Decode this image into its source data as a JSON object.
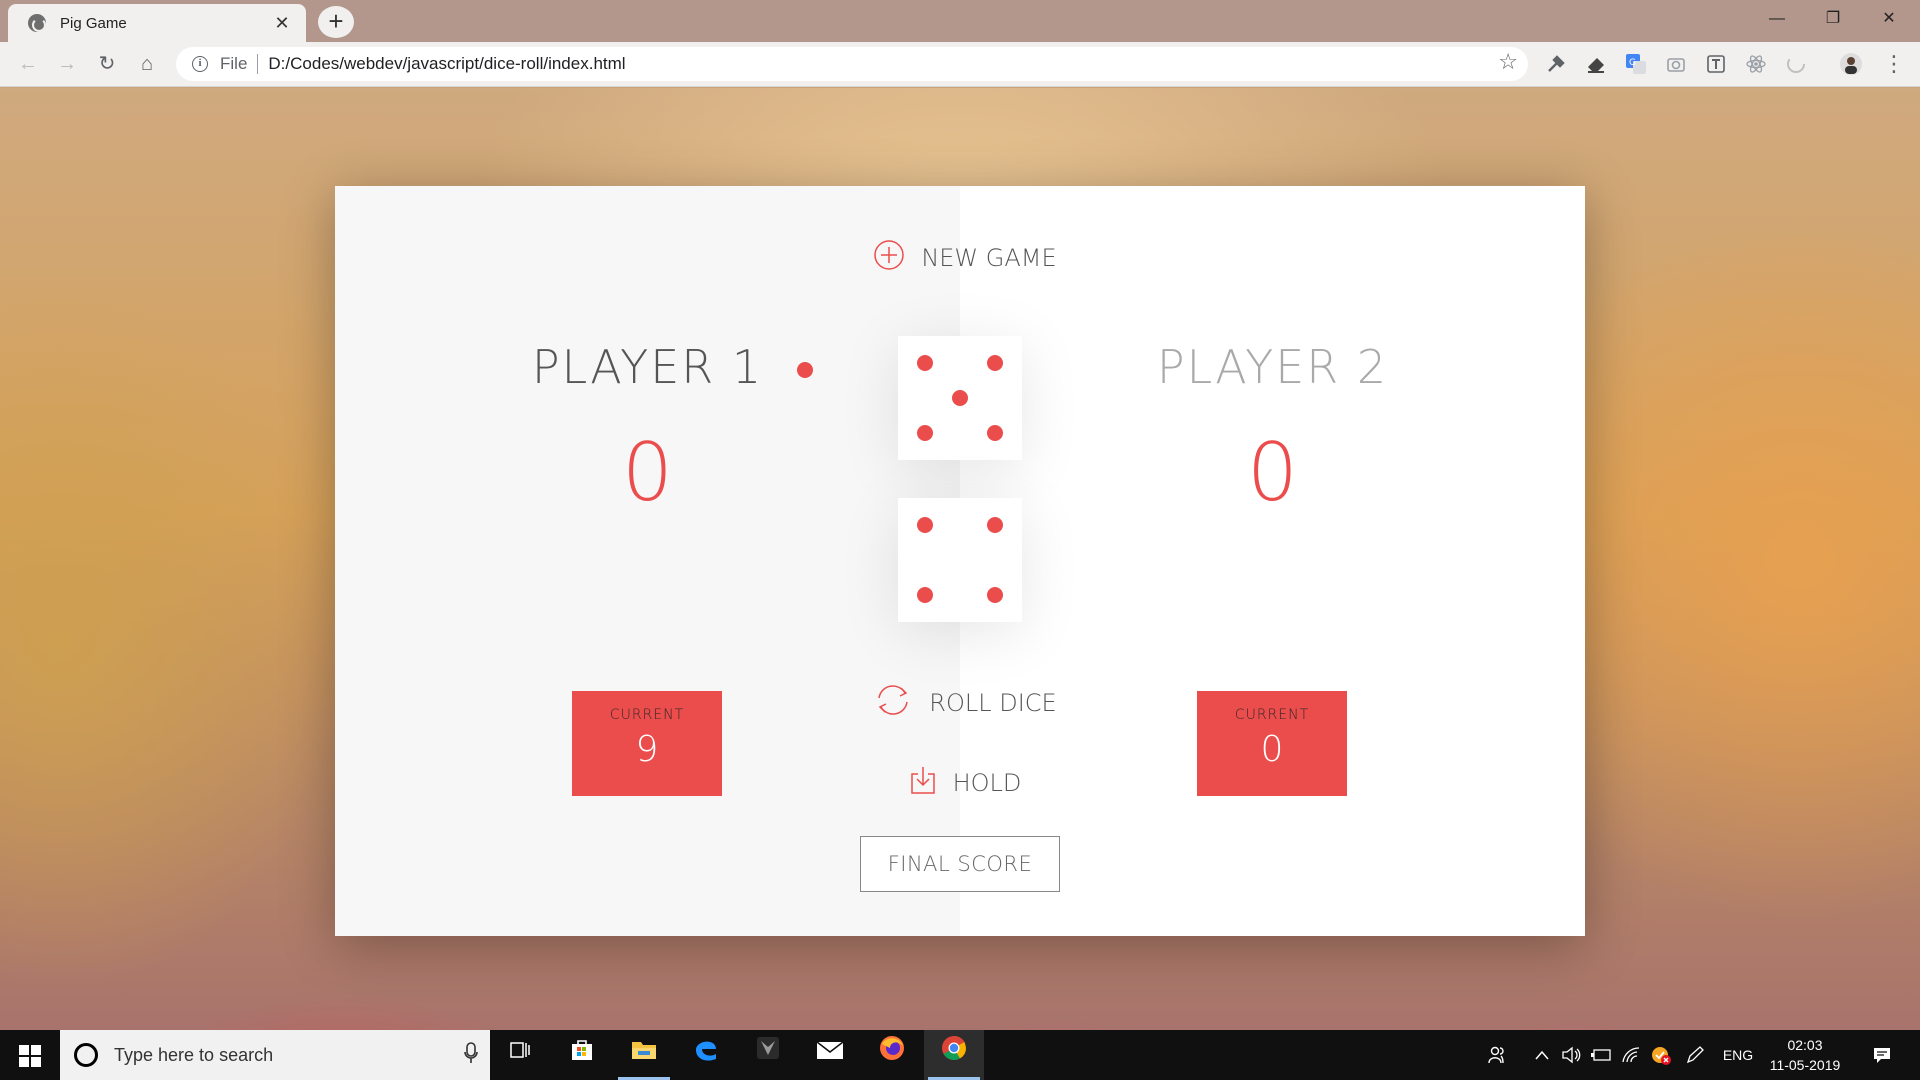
{
  "browser": {
    "tab_title": "Pig Game",
    "tab_close": "✕",
    "new_tab": "+",
    "window_controls": {
      "minimize": "—",
      "maximize": "❐",
      "close": "✕"
    },
    "nav": {
      "back": "←",
      "forward": "→",
      "reload": "↻",
      "home": "⌂"
    },
    "address": {
      "scheme_label": "File",
      "url": "D:/Codes/webdev/javascript/dice-roll/index.html",
      "info": "i"
    },
    "bookmark_star": "☆",
    "menu": "⋮",
    "extensions": [
      "eyedropper-icon",
      "eraser-icon",
      "translate-icon",
      "camera-icon",
      "text-icon",
      "react-icon",
      "loader-icon",
      "avatar-icon"
    ]
  },
  "game": {
    "new_game_label": "NEW GAME",
    "roll_dice_label": "ROLL DICE",
    "hold_label": "HOLD",
    "final_score_placeholder": "FINAL SCORE",
    "active_player": 1,
    "players": [
      {
        "name": "PLAYER 1",
        "score": "0",
        "current_label": "CURRENT",
        "current": "9"
      },
      {
        "name": "PLAYER 2",
        "score": "0",
        "current_label": "CURRENT",
        "current": "0"
      }
    ],
    "dice": [
      5,
      4
    ],
    "accent_color": "#eb4d4d"
  },
  "taskbar": {
    "search_placeholder": "Type here to search",
    "tray_language": "ENG",
    "clock_time": "02:03",
    "clock_date": "11-05-2019",
    "pinned_apps": [
      "task-view-icon",
      "store-icon",
      "file-explorer-icon",
      "edge-icon",
      "game-app-icon",
      "mail-icon",
      "firefox-icon",
      "chrome-icon"
    ]
  }
}
